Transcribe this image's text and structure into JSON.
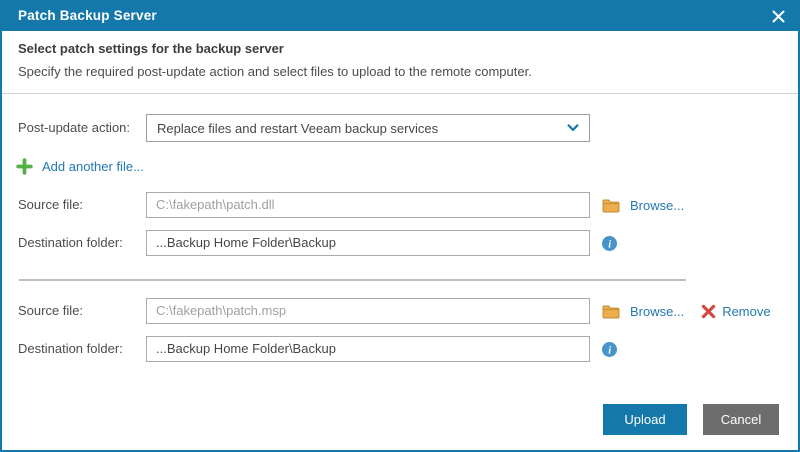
{
  "window": {
    "title": "Patch Backup Server"
  },
  "intro": {
    "heading": "Select patch settings for the backup server",
    "subtitle": "Specify the required post-update action and select files to upload to the remote computer."
  },
  "form": {
    "post_update_label": "Post-update action:",
    "post_update_value": "Replace files and restart Veeam backup services",
    "add_file_label": "Add another file...",
    "source_label": "Source file:",
    "dest_label": "Destination folder:",
    "browse_label": "Browse...",
    "remove_label": "Remove",
    "files": [
      {
        "source": "C:\\fakepath\\patch.dll",
        "destination": "...Backup Home Folder\\Backup"
      },
      {
        "source": "C:\\fakepath\\patch.msp",
        "destination": "...Backup Home Folder\\Backup"
      }
    ]
  },
  "footer": {
    "upload": "Upload",
    "cancel": "Cancel"
  },
  "colors": {
    "header_blue": "#1478ab",
    "link_blue": "#2279b4",
    "add_green": "#53b147",
    "folder_yellow": "#ecae4a",
    "remove_red": "#d14b42",
    "info_blue": "#4795c8",
    "cancel_gray": "#6d6d6d"
  }
}
